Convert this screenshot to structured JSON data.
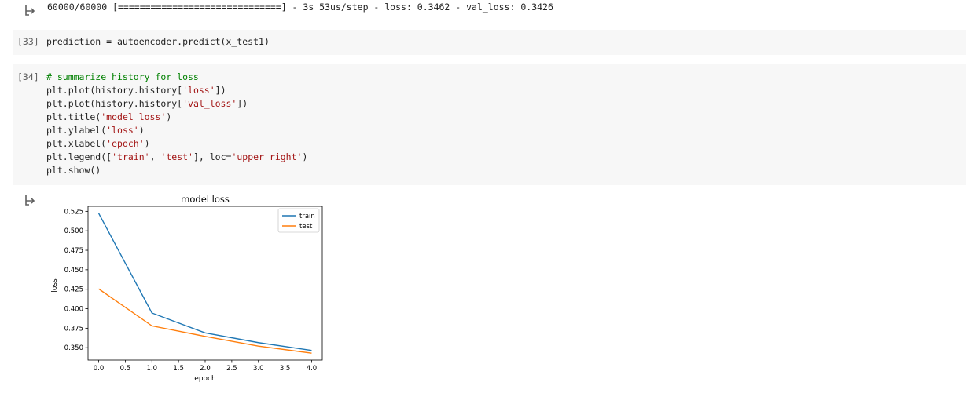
{
  "training_output": "60000/60000 [==============================] - 3s 53us/step - loss: 0.3462 - val_loss: 0.3426",
  "cells": [
    {
      "prompt": "[33]",
      "lines": [
        [
          {
            "t": "prediction = autoencoder.predict(x_test1)",
            "c": ""
          }
        ]
      ]
    },
    {
      "prompt": "[34]",
      "lines": [
        [
          {
            "t": "# summarize history for loss",
            "c": "comment"
          }
        ],
        [
          {
            "t": "plt.plot(history.history[",
            "c": ""
          },
          {
            "t": "'loss'",
            "c": "str"
          },
          {
            "t": "])",
            "c": ""
          }
        ],
        [
          {
            "t": "plt.plot(history.history[",
            "c": ""
          },
          {
            "t": "'val_loss'",
            "c": "str"
          },
          {
            "t": "])",
            "c": ""
          }
        ],
        [
          {
            "t": "plt.title(",
            "c": ""
          },
          {
            "t": "'model loss'",
            "c": "str"
          },
          {
            "t": ")",
            "c": ""
          }
        ],
        [
          {
            "t": "plt.ylabel(",
            "c": ""
          },
          {
            "t": "'loss'",
            "c": "str"
          },
          {
            "t": ")",
            "c": ""
          }
        ],
        [
          {
            "t": "plt.xlabel(",
            "c": ""
          },
          {
            "t": "'epoch'",
            "c": "str"
          },
          {
            "t": ")",
            "c": ""
          }
        ],
        [
          {
            "t": "plt.legend([",
            "c": ""
          },
          {
            "t": "'train'",
            "c": "str"
          },
          {
            "t": ", ",
            "c": ""
          },
          {
            "t": "'test'",
            "c": "str"
          },
          {
            "t": "], loc=",
            "c": ""
          },
          {
            "t": "'upper right'",
            "c": "str"
          },
          {
            "t": ")",
            "c": ""
          }
        ],
        [
          {
            "t": "plt.show()",
            "c": ""
          }
        ]
      ]
    }
  ],
  "chart_data": {
    "type": "line",
    "title": "model loss",
    "xlabel": "epoch",
    "ylabel": "loss",
    "x": [
      0,
      1,
      2,
      3,
      4
    ],
    "series": [
      {
        "name": "train",
        "values": [
          0.5225,
          0.3945,
          0.369,
          0.3565,
          0.3465
        ],
        "color": "#1f77b4"
      },
      {
        "name": "test",
        "values": [
          0.4255,
          0.378,
          0.3645,
          0.352,
          0.343
        ],
        "color": "#ff7f0e"
      }
    ],
    "xticks": [
      "0.0",
      "0.5",
      "1.0",
      "1.5",
      "2.0",
      "2.5",
      "3.0",
      "3.5",
      "4.0"
    ],
    "yticks": [
      "0.350",
      "0.375",
      "0.400",
      "0.425",
      "0.450",
      "0.475",
      "0.500",
      "0.525"
    ],
    "xlim": [
      -0.2,
      4.2
    ],
    "ylim": [
      0.3341,
      0.5314
    ],
    "legend_loc": "upper right",
    "grid": false
  },
  "colors": {
    "cell_bg": "#f7f7f7",
    "comment": "#008000",
    "string": "#a31515",
    "icon": "#616161"
  },
  "icons": [
    "output-arrow-icon"
  ]
}
